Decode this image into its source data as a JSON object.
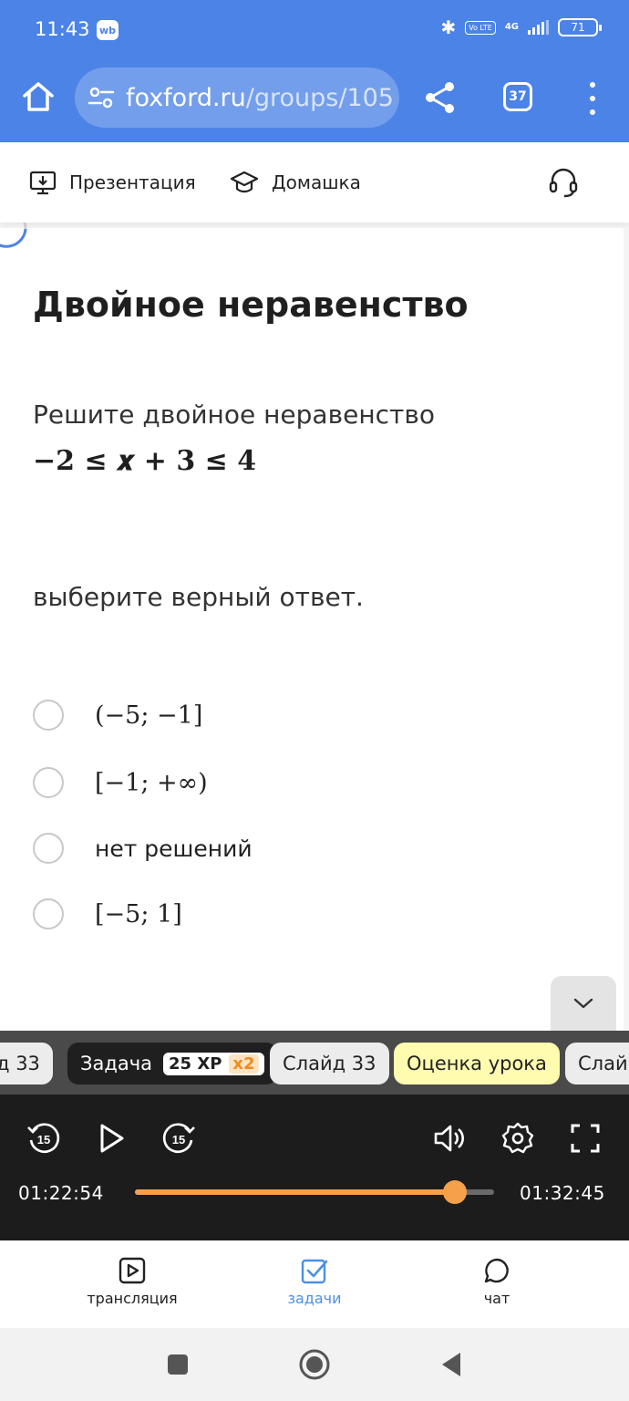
{
  "status_bar": {
    "time": "11:43",
    "app_badge": "wb",
    "volte": "Vo LTE",
    "network": "4G",
    "battery": "71"
  },
  "browser": {
    "url_domain": "foxford.ru",
    "url_path": "/groups/105",
    "tab_count": "37"
  },
  "lesson_header": {
    "presentation_label": "Презентация",
    "homework_label": "Домашка"
  },
  "task": {
    "title": "Двойное неравенство",
    "text": "Решите двойное неравенство",
    "formula": "−2 ≤ 𝒙 + 3 ≤ 4",
    "prompt": "выберите верный ответ.",
    "options": [
      {
        "label": "(−5; −1]",
        "selected": false
      },
      {
        "label": "[−1; +∞)",
        "selected": false
      },
      {
        "label": "нет решений",
        "selected": false
      },
      {
        "label": "[−5; 1]",
        "selected": false
      }
    ]
  },
  "timeline": {
    "prev_chip": "д 33",
    "task_chip": "Задача",
    "xp": "25 XP",
    "multiplier": "x2",
    "slide_chip": "Слайд 33",
    "rating_chip": "Оценка урока",
    "next_chip": "Слай"
  },
  "player": {
    "current_time": "01:22:54",
    "total_time": "01:32:45",
    "progress": 0.89,
    "rewind_seconds": "15",
    "forward_seconds": "15"
  },
  "bottom_nav": {
    "broadcast_label": "трансляция",
    "tasks_label": "задачи",
    "chat_label": "чат",
    "active": "tasks"
  },
  "colors": {
    "brand_blue": "#4c83e6",
    "accent_orange": "#f5a04a",
    "active_nav": "#4c8fe6",
    "rating_chip": "#fffcb0"
  }
}
